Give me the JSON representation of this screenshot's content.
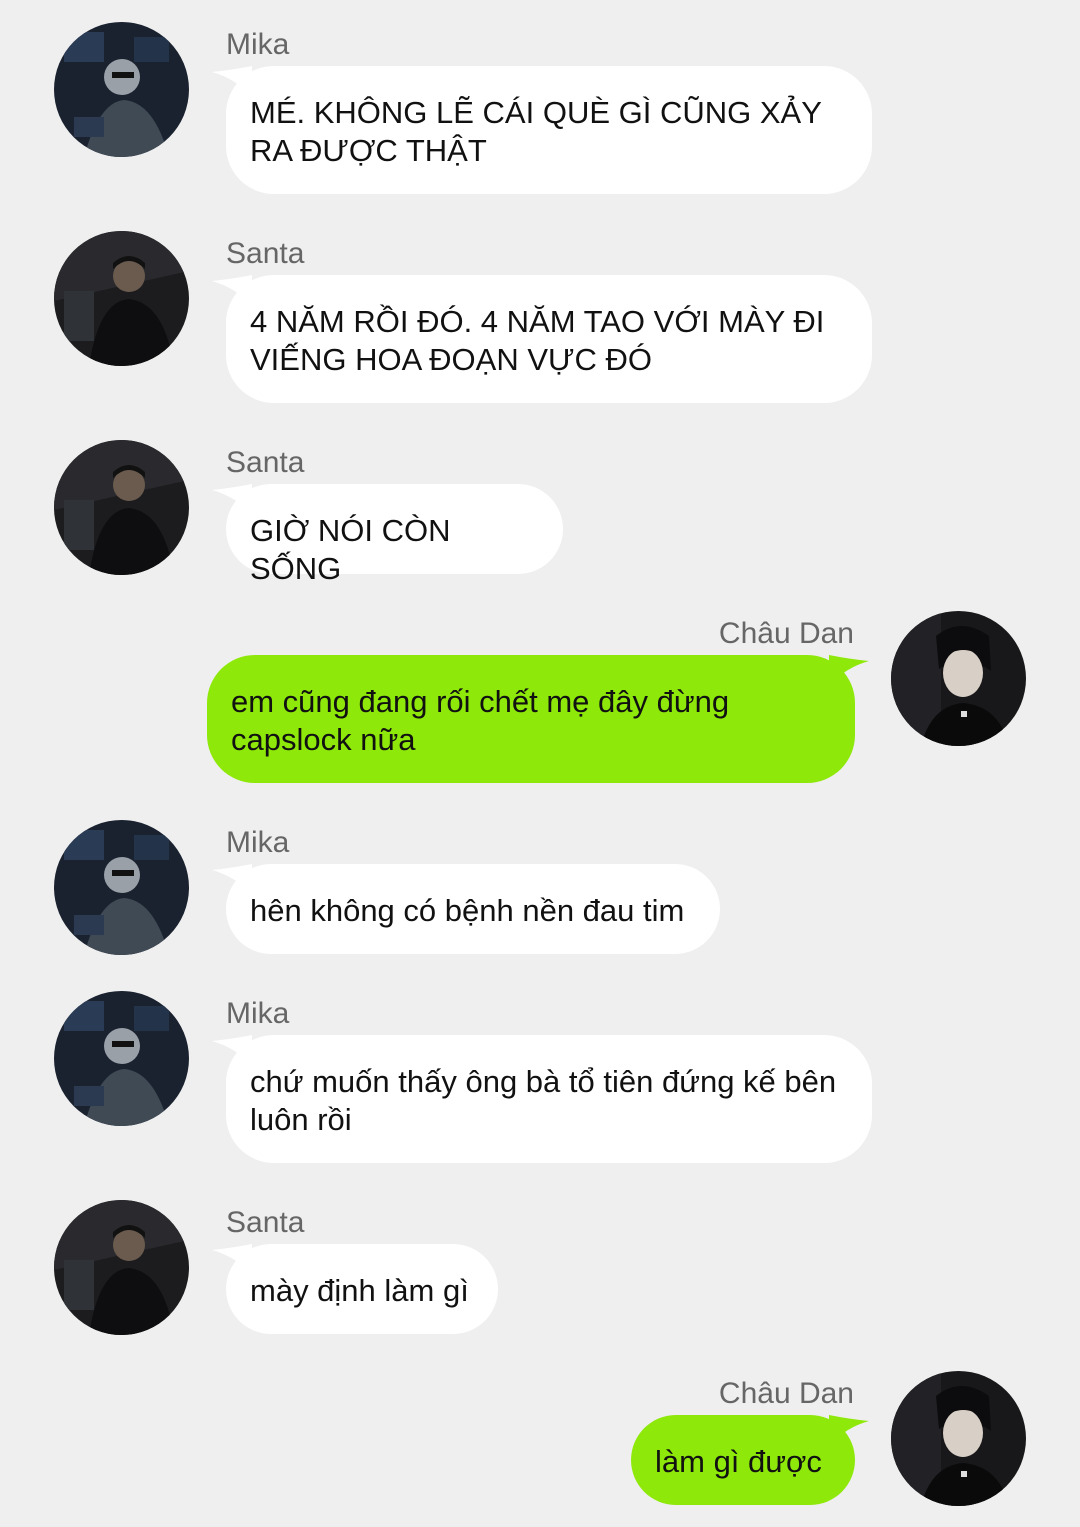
{
  "messages": [
    {
      "sender": "Mika",
      "text": "MÉ. KHÔNG LẼ CÁI QUÈ GÌ CŨNG XẢY RA ĐƯỢC THẬT"
    },
    {
      "sender": "Santa",
      "text": "4 NĂM RỒI ĐÓ. 4 NĂM TAO VỚI MÀY ĐI VIẾNG HOA ĐOẠN VỰC ĐÓ"
    },
    {
      "sender": "Santa",
      "text": "GIỜ NÓI CÒN SỐNG"
    },
    {
      "sender": "Châu Dan",
      "text": "em cũng đang rối chết mẹ đây đừng capslock nữa"
    },
    {
      "sender": "Mika",
      "text": "hên không có bệnh nền đau tim"
    },
    {
      "sender": "Mika",
      "text": "chứ muốn thấy ông bà tổ tiên đứng kế bên luôn rồi"
    },
    {
      "sender": "Santa",
      "text": "mày định làm gì"
    },
    {
      "sender": "Châu Dan",
      "text": "làm gì được"
    }
  ],
  "colors": {
    "background": "#efefef",
    "incoming_bubble": "#ffffff",
    "outgoing_bubble": "#8ee80a",
    "sender_name": "#666666"
  }
}
